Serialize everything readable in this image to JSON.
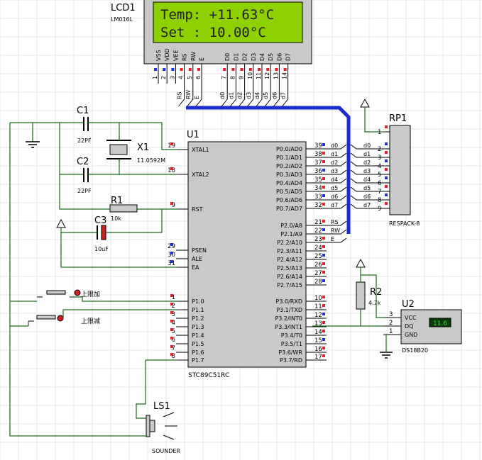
{
  "colors": {
    "wire": "#1a6a1a",
    "bus": "#1c2ccc",
    "lcd_screen": "#8fd000",
    "part_body": "#c9c9c9",
    "pin_red": "#e0202a",
    "pin_blue": "#2030e0",
    "temp_display": "#10a010"
  },
  "lcd": {
    "ref": "LCD1",
    "model": "LM016L",
    "line1": "Temp: +11.63°C",
    "line2": "Set :  10.00°C",
    "pins": [
      "VSS",
      "VDD",
      "VEE",
      "RS",
      "RW",
      "E",
      "D0",
      "D1",
      "D2",
      "D3",
      "D4",
      "D5",
      "D6",
      "D7"
    ],
    "pin_numbers": [
      "1",
      "2",
      "3",
      "4",
      "5",
      "6",
      "7",
      "8",
      "9",
      "10",
      "11",
      "12",
      "13",
      "14"
    ],
    "net_labels": [
      "RS",
      "RW",
      "E",
      "d0",
      "d1",
      "d2",
      "d3",
      "d4",
      "d5",
      "d6",
      "d7"
    ]
  },
  "mcu": {
    "ref": "U1",
    "model": "STC89C51RC",
    "left_pins": [
      {
        "num": "19",
        "name": "XTAL1"
      },
      {
        "num": "18",
        "name": "XTAL2"
      },
      {
        "num": "9",
        "name": "RST"
      },
      {
        "num": "29",
        "name": "PSEN"
      },
      {
        "num": "30",
        "name": "ALE"
      },
      {
        "num": "31",
        "name": "EA"
      },
      {
        "num": "1",
        "name": "P1.0"
      },
      {
        "num": "2",
        "name": "P1.1"
      },
      {
        "num": "3",
        "name": "P1.2"
      },
      {
        "num": "4",
        "name": "P1.3"
      },
      {
        "num": "5",
        "name": "P1.4"
      },
      {
        "num": "6",
        "name": "P1.5"
      },
      {
        "num": "7",
        "name": "P1.6"
      },
      {
        "num": "8",
        "name": "P1.7"
      }
    ],
    "right_pins": [
      {
        "num": "39",
        "name": "P0.0/AD0"
      },
      {
        "num": "38",
        "name": "P0.1/AD1"
      },
      {
        "num": "37",
        "name": "P0.2/AD2"
      },
      {
        "num": "36",
        "name": "P0.3/AD3"
      },
      {
        "num": "35",
        "name": "P0.4/AD4"
      },
      {
        "num": "34",
        "name": "P0.5/AD5"
      },
      {
        "num": "33",
        "name": "P0.6/AD6"
      },
      {
        "num": "32",
        "name": "P0.7/AD7"
      },
      {
        "num": "21",
        "name": "P2.0/A8"
      },
      {
        "num": "22",
        "name": "P2.1/A9"
      },
      {
        "num": "23",
        "name": "P2.2/A10"
      },
      {
        "num": "24",
        "name": "P2.3/A11"
      },
      {
        "num": "25",
        "name": "P2.4/A12"
      },
      {
        "num": "26",
        "name": "P2.5/A13"
      },
      {
        "num": "27",
        "name": "P2.6/A14"
      },
      {
        "num": "28",
        "name": "P2.7/A15"
      },
      {
        "num": "10",
        "name": "P3.0/RXD"
      },
      {
        "num": "11",
        "name": "P3.1/TXD"
      },
      {
        "num": "12",
        "name": "P3.2/INT0"
      },
      {
        "num": "13",
        "name": "P3.3/INT1"
      },
      {
        "num": "14",
        "name": "P3.4/T0"
      },
      {
        "num": "15",
        "name": "P3.5/T1"
      },
      {
        "num": "16",
        "name": "P3.6/WR"
      },
      {
        "num": "17",
        "name": "P3.7/RD"
      }
    ],
    "p0_nets": [
      "d0",
      "d1",
      "d2",
      "d3",
      "d4",
      "d5",
      "d6",
      "d7"
    ],
    "p2_nets": [
      "RS",
      "RW",
      "E"
    ]
  },
  "components": {
    "c1": {
      "ref": "C1",
      "value": "22PF"
    },
    "c2": {
      "ref": "C2",
      "value": "22PF"
    },
    "x1": {
      "ref": "X1",
      "value": "11.0592M"
    },
    "r1": {
      "ref": "R1",
      "value": "10k"
    },
    "c3": {
      "ref": "C3",
      "value": "10uF"
    },
    "r2": {
      "ref": "R2",
      "value": "4.7k"
    },
    "ls1": {
      "ref": "LS1",
      "value": "SOUNDER"
    },
    "btn_up": {
      "label": "上限加"
    },
    "btn_down": {
      "label": "上限减"
    }
  },
  "rp1": {
    "ref": "RP1",
    "model": "RESPACK-8",
    "pin_numbers": [
      "1",
      "2",
      "3",
      "4",
      "5",
      "6",
      "7",
      "8",
      "9"
    ],
    "nets": [
      "d0",
      "d1",
      "d2",
      "d3",
      "d4",
      "d5",
      "d6",
      "d7"
    ]
  },
  "u2": {
    "ref": "U2",
    "model": "DS18B20",
    "pins": [
      {
        "num": "3",
        "name": "VCC"
      },
      {
        "num": "2",
        "name": "DQ"
      },
      {
        "num": "1",
        "name": "GND"
      }
    ],
    "reading": "11.6"
  }
}
